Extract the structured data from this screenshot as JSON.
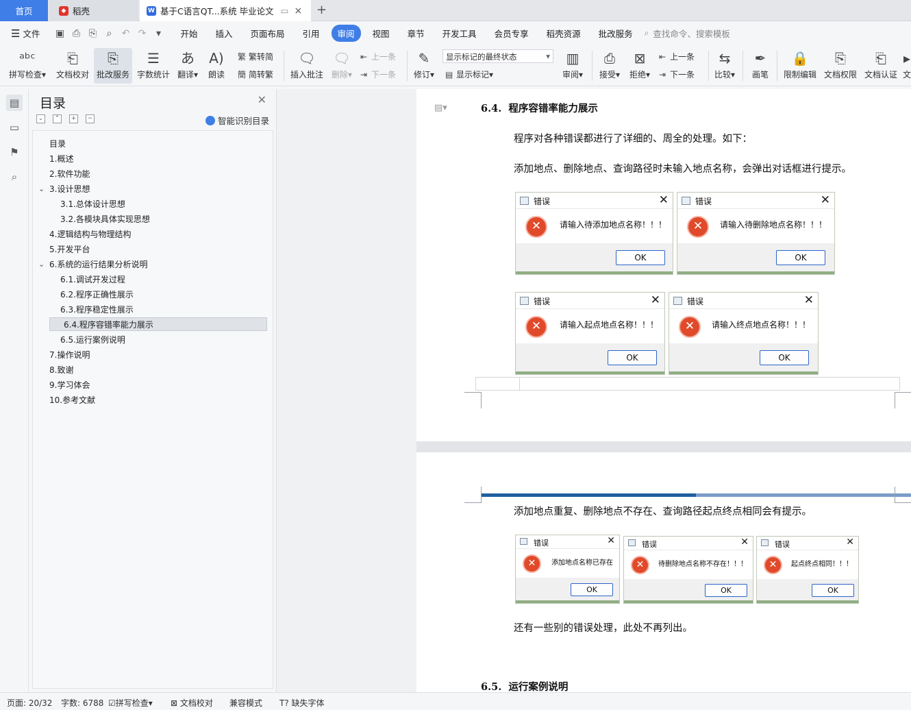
{
  "tabs": {
    "home": "首页",
    "docer": "稻壳",
    "document": "基于C语言QT...系统 毕业论文"
  },
  "menu": {
    "file": "文件",
    "items": [
      "开始",
      "插入",
      "页面布局",
      "引用",
      "审阅",
      "视图",
      "章节",
      "开发工具",
      "会员专享",
      "稻壳资源",
      "批改服务"
    ],
    "active": "审阅",
    "search_placeholder": "查找命令、搜索模板"
  },
  "ribbon": {
    "spell_check": "拼写检查",
    "doc_proofread": "文档校对",
    "review_service": "批改服务",
    "word_count": "字数统计",
    "translate": "翻译",
    "read_aloud": "朗读",
    "trad_conv": "繁转简",
    "simp_conv": "简转繁",
    "insert_comment": "插入批注",
    "delete": "删除",
    "prev": "上一条",
    "next": "下一条",
    "track": "修订",
    "markup_state": "显示标记的最终状态",
    "show_markup": "显示标记",
    "review": "审阅",
    "accept": "接受",
    "reject": "拒绝",
    "prev2": "上一条",
    "next2": "下一条",
    "compare": "比较",
    "pen": "画笔",
    "restrict_edit": "限制编辑",
    "doc_permission": "文档权限",
    "doc_certify": "文档认证",
    "more": "文"
  },
  "toc": {
    "title": "目录",
    "ai_label": "智能识别目录",
    "items": [
      {
        "label": "目录",
        "level": 1
      },
      {
        "label": "1.概述",
        "level": 1
      },
      {
        "label": "2.软件功能",
        "level": 1
      },
      {
        "label": "3.设计思想",
        "level": 1,
        "expanded": true
      },
      {
        "label": "3.1.总体设计思想",
        "level": 2
      },
      {
        "label": "3.2.各模块具体实现思想",
        "level": 2
      },
      {
        "label": "4.逻辑结构与物理结构",
        "level": 1
      },
      {
        "label": "5.开发平台",
        "level": 1
      },
      {
        "label": "6.系统的运行结果分析说明",
        "level": 1,
        "expanded": true
      },
      {
        "label": "6.1.调试开发过程",
        "level": 2
      },
      {
        "label": "6.2.程序正确性展示",
        "level": 2
      },
      {
        "label": "6.3.程序稳定性展示",
        "level": 2
      },
      {
        "label": "6.4.程序容错率能力展示",
        "level": 2,
        "selected": true
      },
      {
        "label": "6.5.运行案例说明",
        "level": 2
      },
      {
        "label": "7.操作说明",
        "level": 1
      },
      {
        "label": "8.致谢",
        "level": 1
      },
      {
        "label": "9.学习体会",
        "level": 1
      },
      {
        "label": "10.参考文献",
        "level": 1
      }
    ]
  },
  "doc": {
    "h64_num": "6.4.",
    "h64_title": "程序容错率能力展示",
    "p1": "程序对各种错误都进行了详细的、周全的处理。如下：",
    "p2": "添加地点、删除地点、查询路径时未输入地点名称，会弹出对话框进行提示。",
    "p3": "添加地点重复、删除地点不存在、查询路径起点终点相同会有提示。",
    "p4": "还有一些别的错误处理，此处不再列出。",
    "h65_num": "6.5.",
    "h65_title": "运行案例说明",
    "dialog_title": "错误",
    "ok": "OK",
    "dialogs": [
      "请输入待添加地点名称！！！",
      "请输入待删除地点名称！！！",
      "请输入起点地点名称！！！",
      "请输入终点地点名称！！！",
      "添加地点名称已存在",
      "待删除地点名称不存在！！！",
      "起点终点相同！！！"
    ]
  },
  "status": {
    "page": "页面: 20/32",
    "words": "字数: 6788",
    "spell": "拼写检查",
    "proof": "文档校对",
    "compat": "兼容模式",
    "missing_font": "缺失字体"
  }
}
